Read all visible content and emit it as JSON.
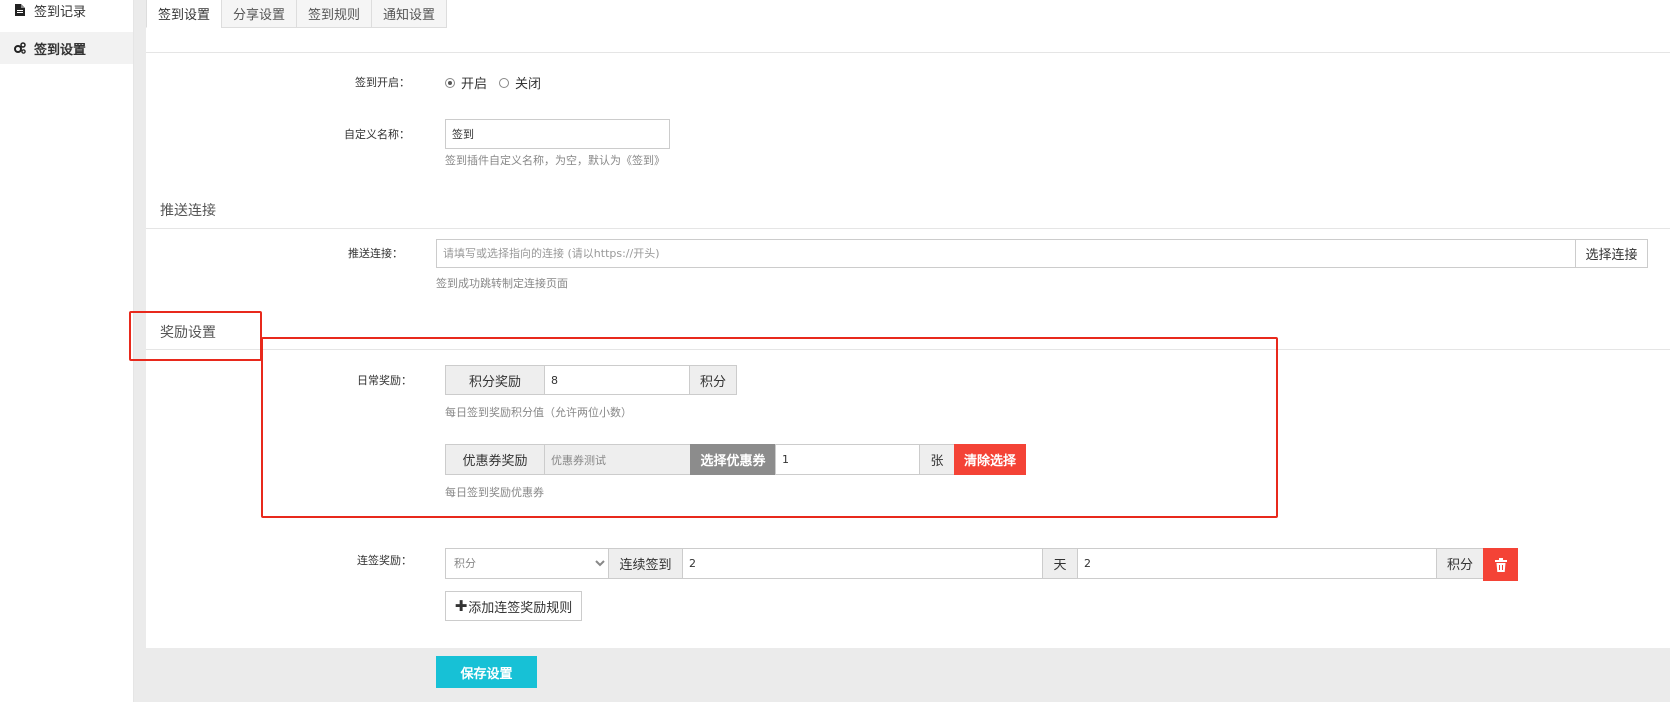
{
  "sidebar": {
    "items": [
      {
        "label": "签到记录",
        "icon": "document-icon"
      },
      {
        "label": "签到设置",
        "icon": "gears-icon"
      }
    ]
  },
  "tabs": [
    "签到设置",
    "分享设置",
    "签到规则",
    "通知设置"
  ],
  "sign_enable": {
    "label": "签到开启：",
    "options": [
      "开启",
      "关闭"
    ],
    "selected": "开启"
  },
  "custom_name": {
    "label": "自定义名称：",
    "value": "签到",
    "help": "签到插件自定义名称，为空，默认为《签到》"
  },
  "push_section": {
    "title": "推送连接"
  },
  "push_link": {
    "label": "推送连接：",
    "placeholder": "请填写或选择指向的连接 (请以https://开头)",
    "button": "选择连接",
    "help": "签到成功跳转制定连接页面"
  },
  "reward_section": {
    "title": "奖励设置"
  },
  "daily_reward": {
    "label": "日常奖励：",
    "points_addon": "积分奖励",
    "points_value": "8",
    "points_unit": "积分",
    "points_help": "每日签到奖励积分值（允许两位小数）",
    "coupon_addon": "优惠券奖励",
    "coupon_name": "优惠券测试",
    "choose_coupon": "选择优惠券",
    "coupon_qty": "1",
    "coupon_unit": "张",
    "clear_button": "清除选择",
    "coupon_help": "每日签到奖励优惠券"
  },
  "streak_reward": {
    "label": "连签奖励：",
    "type_selected": "积分",
    "streak_addon": "连续签到",
    "days_value": "2",
    "days_unit": "天",
    "points_value": "2",
    "points_unit": "积分",
    "add_rule_button": "添加连签奖励规则"
  },
  "save_button": "保存设置",
  "colors": {
    "accent": "#17c1d6",
    "danger": "#f44336",
    "highlight": "#e8291c"
  }
}
